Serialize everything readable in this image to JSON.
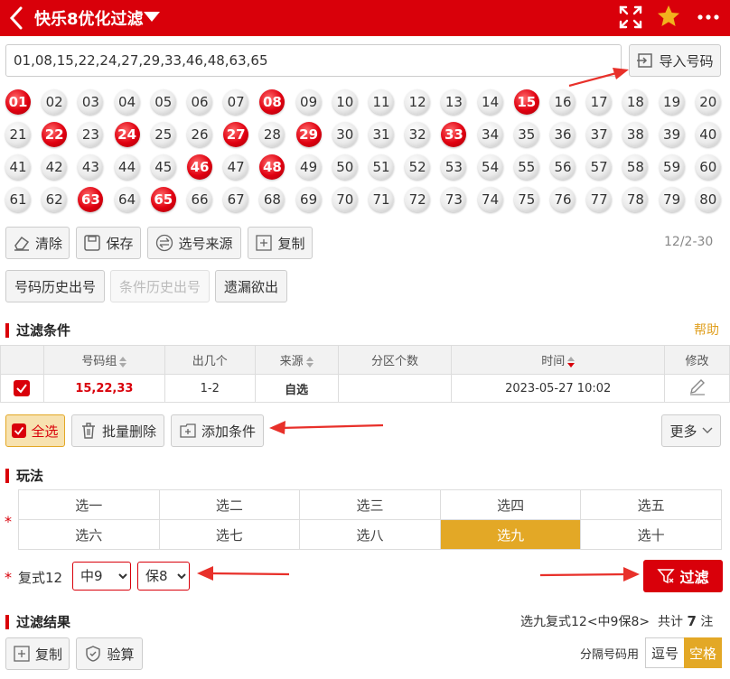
{
  "header": {
    "title": "快乐8优化过滤"
  },
  "input": {
    "value": "01,08,15,22,24,27,29,33,46,48,63,65",
    "import_label": "导入号码"
  },
  "balls": [
    "01",
    "02",
    "03",
    "04",
    "05",
    "06",
    "07",
    "08",
    "09",
    "10",
    "11",
    "12",
    "13",
    "14",
    "15",
    "16",
    "17",
    "18",
    "19",
    "20",
    "21",
    "22",
    "23",
    "24",
    "25",
    "26",
    "27",
    "28",
    "29",
    "30",
    "31",
    "32",
    "33",
    "34",
    "35",
    "36",
    "37",
    "38",
    "39",
    "40",
    "41",
    "42",
    "43",
    "44",
    "45",
    "46",
    "47",
    "48",
    "49",
    "50",
    "51",
    "52",
    "53",
    "54",
    "55",
    "56",
    "57",
    "58",
    "59",
    "60",
    "61",
    "62",
    "63",
    "64",
    "65",
    "66",
    "67",
    "68",
    "69",
    "70",
    "71",
    "72",
    "73",
    "74",
    "75",
    "76",
    "77",
    "78",
    "79",
    "80"
  ],
  "selected_balls": [
    "01",
    "08",
    "15",
    "22",
    "24",
    "27",
    "29",
    "33",
    "46",
    "48",
    "63",
    "65"
  ],
  "toolbar": {
    "clear": "清除",
    "save": "保存",
    "source": "选号来源",
    "copy": "复制",
    "count": "12/2-30"
  },
  "history": {
    "number_history": "号码历史出号",
    "condition_history": "条件历史出号",
    "missing": "遗漏欲出"
  },
  "filter_section": {
    "title": "过滤条件",
    "help": "帮助"
  },
  "table": {
    "headers": [
      "号码组",
      "出几个",
      "来源",
      "分区个数",
      "时间",
      "修改"
    ],
    "rows": [
      {
        "numbers": "15,22,33",
        "count": "1-2",
        "source": "自选",
        "zones": "",
        "time": "2023-05-27 10:02"
      }
    ]
  },
  "actions": {
    "select_all": "全选",
    "batch_delete": "批量删除",
    "add_condition": "添加条件",
    "more": "更多"
  },
  "play": {
    "title": "玩法",
    "options": [
      "选一",
      "选二",
      "选三",
      "选四",
      "选五",
      "选六",
      "选七",
      "选八",
      "选九",
      "选十"
    ],
    "selected": "选九"
  },
  "compound": {
    "label": "复式12",
    "hit": "中9",
    "hit_options": [
      "中9"
    ],
    "guarantee": "保8",
    "guarantee_options": [
      "保8"
    ],
    "filter_label": "过滤"
  },
  "result": {
    "title": "过滤结果",
    "summary_prefix": "选九复式12<中9保8>  共计",
    "total": "7",
    "summary_suffix": "注",
    "copy": "复制",
    "verify": "验算",
    "separator_label": "分隔号码用",
    "comma": "逗号",
    "space": "空格"
  },
  "colors": {
    "brand": "#d9000a",
    "accent": "#e3a826"
  }
}
